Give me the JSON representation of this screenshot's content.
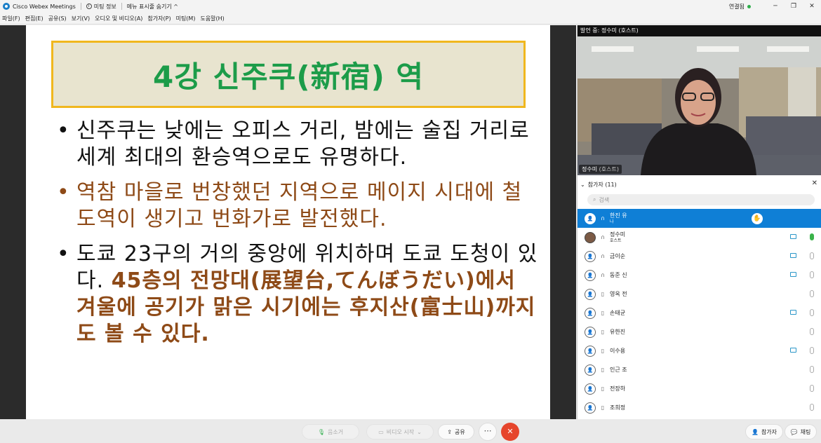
{
  "window": {
    "app_title": "Cisco Webex Meetings",
    "meeting_info": "미팅 정보",
    "hide_menu": "메뉴 표시줄 숨기기",
    "connection": "연결됨",
    "connection_color": "#2fae4b"
  },
  "menu": [
    "파일(F)",
    "편집(E)",
    "공유(S)",
    "보기(V)",
    "오디오 및 비디오(A)",
    "참가자(P)",
    "미팅(M)",
    "도움말(H)"
  ],
  "slide": {
    "title": "4강 신주쿠(新宿) 역",
    "b1": "신주쿠는 낮에는 오피스 거리, 밤에는 술집 거리로 세계 최대의 환승역으로도 유명하다.",
    "b2": "역참 마을로 번창했던 지역으로 메이지 시대에 철도역이 생기고 번화가로 발전했다.",
    "b3a": "도쿄 23구의 거의 중앙에 위치하며 도쿄 도청이 있다.",
    "b3b": "45층의 전망대(展望台,てんぼうだい)에서 겨울에 공기가 맑은 시기에는 후지산(富士山)까지도 볼 수 있다.",
    "title_color": "#1c9c49",
    "accent_color": "#8e4a17"
  },
  "video": {
    "speaking": "발언 중: 정수미 (호스트)",
    "name": "정수미",
    "name_role": "(호스트)"
  },
  "participants": {
    "header": "참가자 (11)",
    "search_placeholder": "검색",
    "rows": [
      {
        "name": "한진 유",
        "role": "나",
        "selected": true,
        "camera": false
      },
      {
        "name": "정수미",
        "role": "호스트",
        "selected": false,
        "camera": true
      },
      {
        "name": "금이순",
        "role": "",
        "selected": false,
        "camera": true
      },
      {
        "name": "동준 신",
        "role": "",
        "selected": false,
        "camera": true
      },
      {
        "name": "영옥 전",
        "role": "",
        "selected": false,
        "camera": false
      },
      {
        "name": "손태균",
        "role": "",
        "selected": false,
        "camera": true
      },
      {
        "name": "유한진",
        "role": "",
        "selected": false,
        "camera": false
      },
      {
        "name": "이수용",
        "role": "",
        "selected": false,
        "camera": true
      },
      {
        "name": "인근 조",
        "role": "",
        "selected": false,
        "camera": false
      },
      {
        "name": "전장하",
        "role": "",
        "selected": false,
        "camera": false
      },
      {
        "name": "조희정",
        "role": "",
        "selected": false,
        "camera": false
      }
    ]
  },
  "toolbar": {
    "mute": "음소거",
    "video": "비디오 시작",
    "share": "공유",
    "participants": "참가자",
    "chat": "채팅"
  }
}
